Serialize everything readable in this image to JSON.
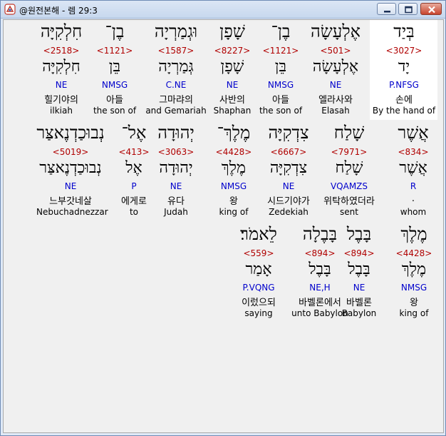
{
  "window": {
    "title": "@원전본해 - 렘 29:3"
  },
  "rows": [
    [
      {
        "heb": "בְּיַד",
        "strong": "<3027>",
        "lemma": "יָד",
        "morph": "P.NFSG",
        "korean": "손에",
        "english": "By the hand of"
      },
      {
        "heb": "אֶלְעָשָׂה",
        "strong": "<501>",
        "lemma": "אֶלְעָשָׂה",
        "morph": "NE",
        "korean": "엘라사와",
        "english": "Elasah"
      },
      {
        "heb": "בֶן־",
        "strong": "<1121>",
        "lemma": "בֵּן",
        "morph": "NMSG",
        "korean": "아들",
        "english": "the son of"
      },
      {
        "heb": "שָׁפָן",
        "strong": "<8227>",
        "lemma": "שָׁפָן",
        "morph": "NE",
        "korean": "사반의",
        "english": "Shaphan"
      },
      {
        "heb": "וּגְמַרְיָה",
        "strong": "<1587>",
        "lemma": "גְּמַרְיָה",
        "morph": "C.NE",
        "korean": "그마랴의",
        "english": "and Gemariah"
      },
      {
        "heb": "בֶן־",
        "strong": "<1121>",
        "lemma": "בֵּן",
        "morph": "NMSG",
        "korean": "아들",
        "english": "the son of"
      },
      {
        "heb": "חִלְקִיָּה",
        "strong": "<2518>",
        "lemma": "חִלְקִיָּה",
        "morph": "NE",
        "korean": "힐기야의",
        "english": "ilkiah"
      }
    ],
    [
      {
        "heb": "אֲשֶׁר",
        "strong": "<834>",
        "lemma": "אֲשֶׁר",
        "morph": "R",
        "korean": ".",
        "english": "whom"
      },
      {
        "heb": "שָׁלַח",
        "strong": "<7971>",
        "lemma": "שָׁלַח",
        "morph": "VQAMZS",
        "korean": "위탁하였더라",
        "english": "sent"
      },
      {
        "heb": "צִדְקִיָּה",
        "strong": "<6667>",
        "lemma": "צִדְקִיָּה",
        "morph": "NE",
        "korean": "시드기야가",
        "english": "Zedekiah"
      },
      {
        "heb": "מֶלֶךְ־",
        "strong": "<4428>",
        "lemma": "מֶלֶךְ",
        "morph": "NMSG",
        "korean": "왕",
        "english": "king of"
      },
      {
        "heb": "יְהוּדָה",
        "strong": "<3063>",
        "lemma": "יְהוּדָה",
        "morph": "NE",
        "korean": "유다",
        "english": "Judah"
      },
      {
        "heb": "אֶל־",
        "strong": "<413>",
        "lemma": "אֶל",
        "morph": "P",
        "korean": "에게로",
        "english": "to"
      },
      {
        "heb": "נְבוּכַדְנֶאצַּר",
        "strong": "<5019>",
        "lemma": "נְבוּכַדְנֶאצַּר",
        "morph": "NE",
        "korean": "느부갓네살",
        "english": "Nebuchadnezzar"
      }
    ],
    [
      {
        "heb": "מֶלֶךְ",
        "strong": "<4428>",
        "lemma": "מֶלֶךְ",
        "morph": "NMSG",
        "korean": "왕",
        "english": "king of"
      },
      {
        "heb": "בָּבֶל",
        "strong": "<894>",
        "lemma": "בָּבֶל",
        "morph": "NE",
        "korean": "바벨론",
        "english": "Babylon"
      },
      {
        "heb": "בָּבֶלָה",
        "strong": "<894>",
        "lemma": "בָּבֶל",
        "morph": "NE,H",
        "korean": "바벨론에서",
        "english": "unto Babylon"
      },
      {
        "heb": "לֵאמֹר׃",
        "strong": "<559>",
        "lemma": "אָמַר",
        "morph": "P.VQNG",
        "korean": "이렀으되",
        "english": "saying"
      }
    ]
  ]
}
